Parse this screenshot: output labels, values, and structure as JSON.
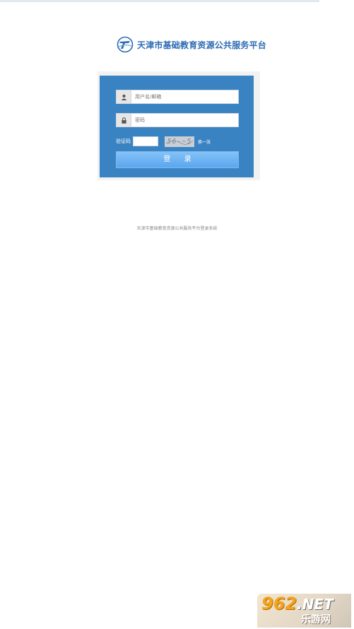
{
  "header": {
    "title": "天津市基础教育资源公共服务平台",
    "logo_icon": "tj-edu-logo-icon"
  },
  "login": {
    "username_placeholder": "用户名/邮箱",
    "password_placeholder": "密码",
    "captcha_label": "验证码",
    "captcha_text": "56-~5",
    "captcha_refresh": "换一张",
    "submit_label": "登 录"
  },
  "footer": {
    "text": "天津市基础教育资源公共服务平台登录系统"
  },
  "watermark": {
    "main": "962",
    "net": ".NET",
    "sub": "乐游网"
  },
  "colors": {
    "brand": "#2d6bb3",
    "panel": "#3a83c3",
    "button": "#5aa6ee"
  }
}
